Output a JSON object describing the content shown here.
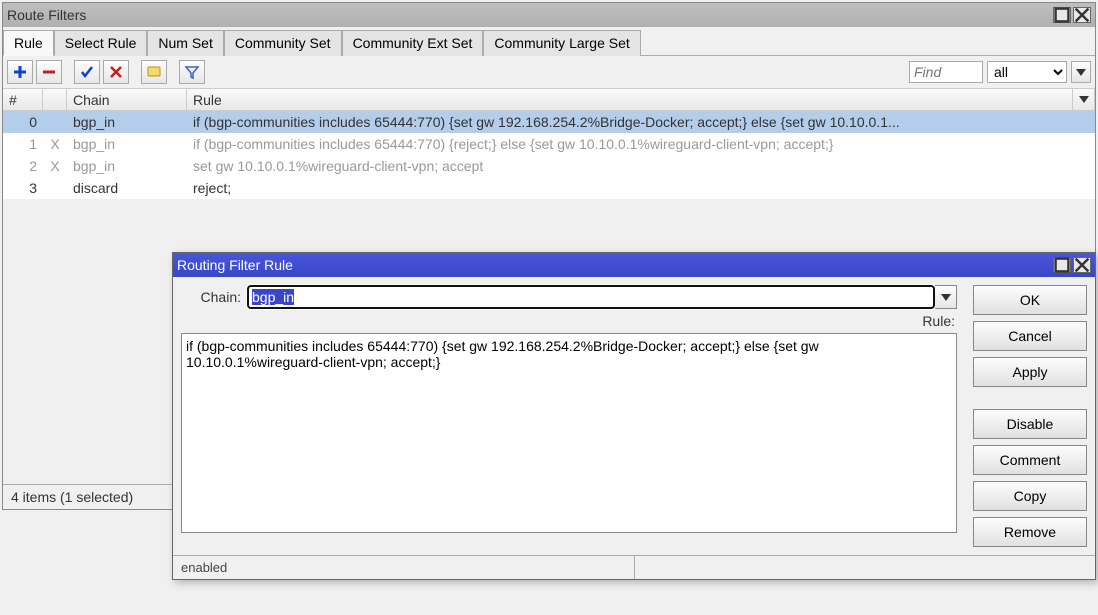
{
  "main": {
    "title": "Route Filters",
    "tabs": [
      "Rule",
      "Select Rule",
      "Num Set",
      "Community Set",
      "Community Ext Set",
      "Community Large Set"
    ],
    "active_tab": 0,
    "find_placeholder": "Find",
    "filter_scope": "all",
    "columns": {
      "idx": "#",
      "chain": "Chain",
      "rule": "Rule"
    },
    "rows": [
      {
        "idx": "0",
        "flag": "",
        "chain": "bgp_in",
        "rule": "if (bgp-communities includes 65444:770) {set gw 192.168.254.2%Bridge-Docker; accept;} else {set gw 10.10.0.1...",
        "selected": true,
        "disabled": false
      },
      {
        "idx": "1",
        "flag": "X",
        "chain": "bgp_in",
        "rule": "if (bgp-communities includes 65444:770) {reject;} else {set gw 10.10.0.1%wireguard-client-vpn; accept;}",
        "selected": false,
        "disabled": true
      },
      {
        "idx": "2",
        "flag": "X",
        "chain": "bgp_in",
        "rule": "set gw 10.10.0.1%wireguard-client-vpn; accept",
        "selected": false,
        "disabled": true
      },
      {
        "idx": "3",
        "flag": "",
        "chain": "discard",
        "rule": "reject;",
        "selected": false,
        "disabled": false
      }
    ],
    "status": "4 items (1 selected)"
  },
  "dialog": {
    "title": "Routing Filter Rule",
    "chain_label": "Chain:",
    "chain_value": "bgp_in",
    "rule_label": "Rule:",
    "rule_text": "if (bgp-communities includes 65444:770) {set gw 192.168.254.2%Bridge-Docker; accept;} else {set gw 10.10.0.1%wireguard-client-vpn; accept;}",
    "buttons": {
      "ok": "OK",
      "cancel": "Cancel",
      "apply": "Apply",
      "disable": "Disable",
      "comment": "Comment",
      "copy": "Copy",
      "remove": "Remove"
    },
    "status_left": "enabled",
    "status_right": ""
  },
  "icons": {
    "add": "add-icon",
    "remove": "remove-icon",
    "enable": "enable-icon",
    "disable": "disable-icon",
    "comment": "comment-icon",
    "filter": "filter-icon"
  }
}
